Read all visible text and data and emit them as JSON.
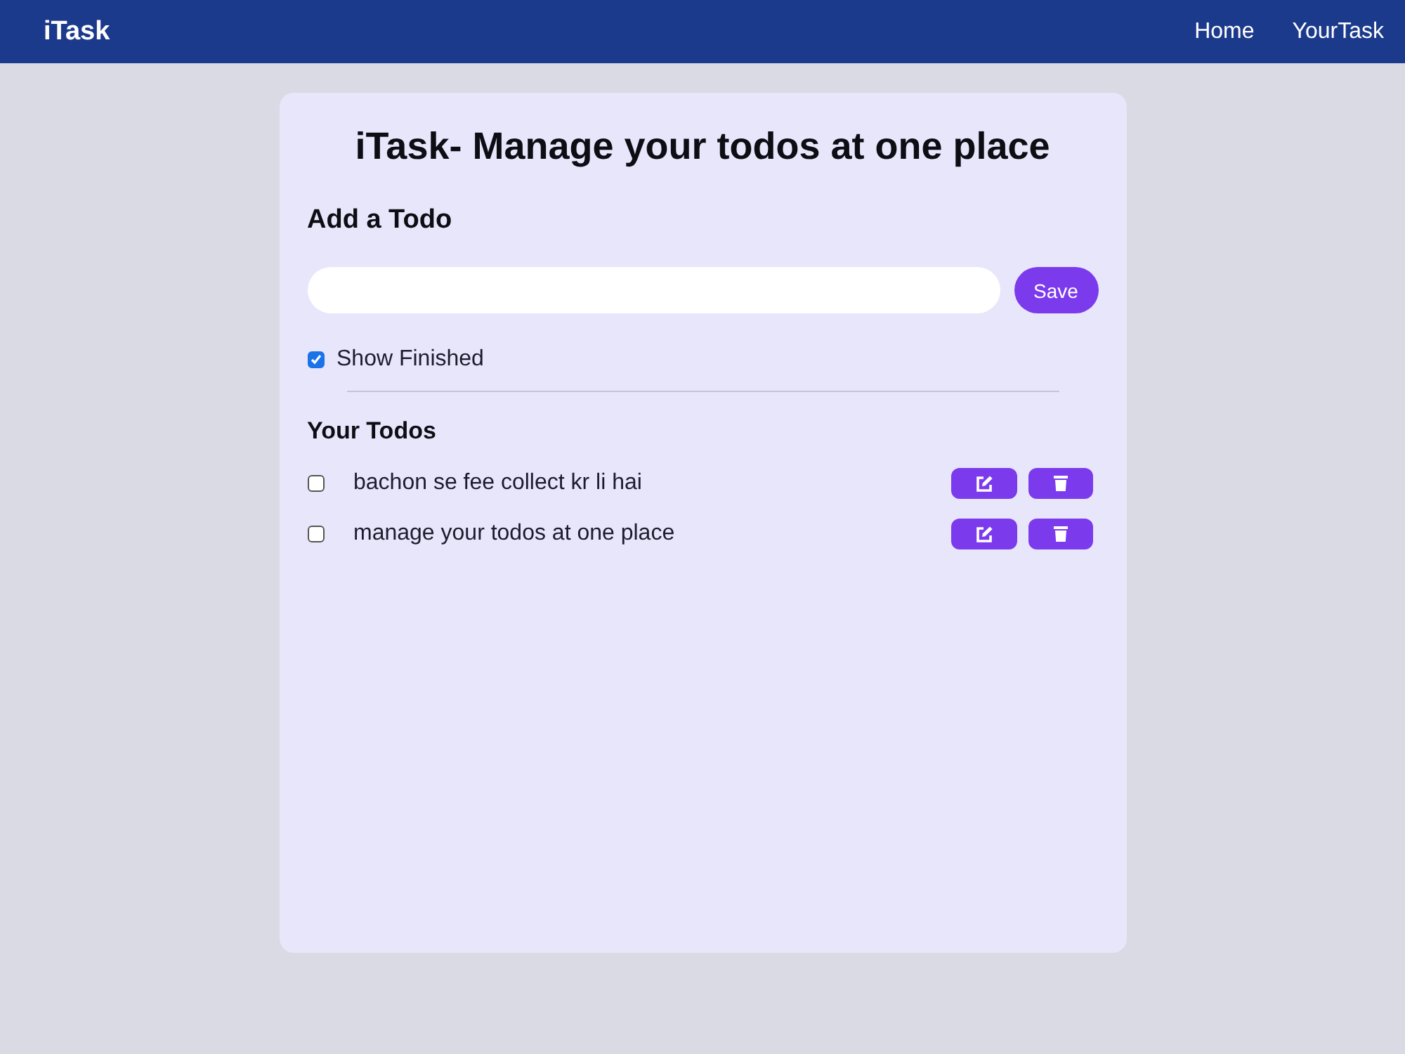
{
  "navbar": {
    "logo": "iTask",
    "links": [
      {
        "label": "Home"
      },
      {
        "label": "YourTask"
      }
    ]
  },
  "card": {
    "title": "iTask- Manage your todos at one place",
    "add_heading": "Add a Todo",
    "save_button": "Save",
    "show_finished": {
      "label": "Show Finished",
      "checked": true
    },
    "list_heading": "Your Todos",
    "todos": [
      {
        "text": "bachon se fee collect kr li hai",
        "completed": false
      },
      {
        "text": "manage your todos at one place",
        "completed": false
      }
    ]
  }
}
